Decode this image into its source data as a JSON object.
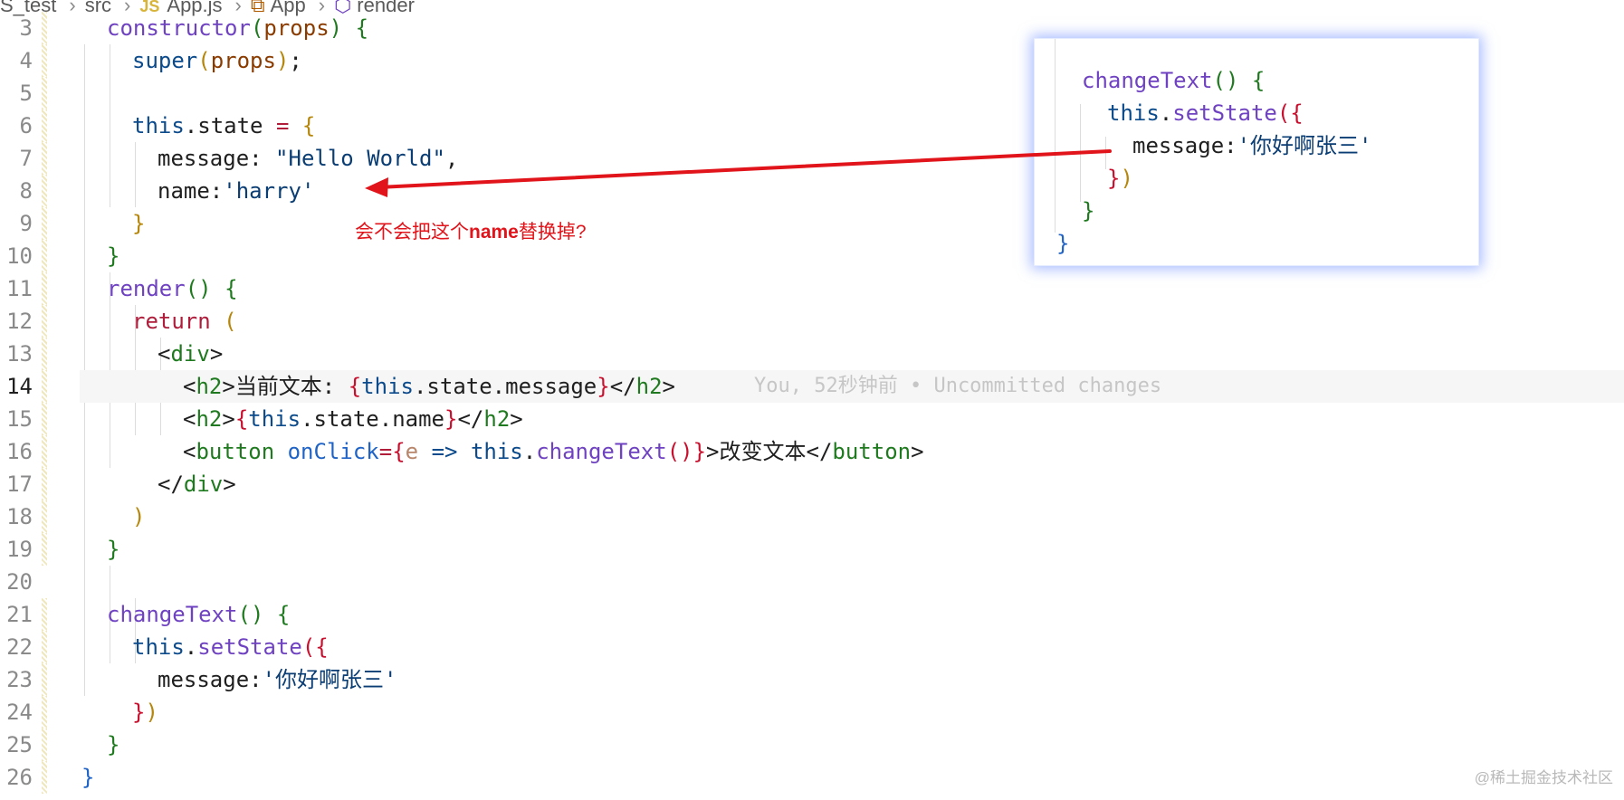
{
  "breadcrumb": {
    "segments": [
      "S_test",
      "src",
      "App.js",
      "App",
      "render"
    ],
    "js_badge": "JS"
  },
  "editor": {
    "line_numbers": [
      "3",
      "4",
      "5",
      "6",
      "7",
      "8",
      "9",
      "10",
      "11",
      "12",
      "13",
      "14",
      "15",
      "16",
      "17",
      "18",
      "19",
      "20",
      "21",
      "22",
      "23",
      "24",
      "25",
      "26"
    ],
    "active_line": "14",
    "code": {
      "l3": {
        "a": "constructor",
        "b": "(",
        "c": "props",
        "d": ")",
        "e": " ",
        "f": "{"
      },
      "l4": {
        "a": "super",
        "b": "(",
        "c": "props",
        "d": ")",
        "e": ";"
      },
      "l6": {
        "a": "this",
        "b": ".state ",
        "c": "=",
        "d": " ",
        "e": "{"
      },
      "l7": {
        "a": "message: ",
        "b": "\"Hello World\"",
        "c": ","
      },
      "l8": {
        "a": "name:",
        "b": "'harry'"
      },
      "l9": {
        "a": "}"
      },
      "l10": {
        "a": "}"
      },
      "l11": {
        "a": "render",
        "b": "()",
        "c": " ",
        "d": "{"
      },
      "l12": {
        "a": "return",
        "b": " ",
        "c": "("
      },
      "l13": {
        "a": "<",
        "b": "div",
        "c": ">"
      },
      "l14": {
        "a": "<",
        "b": "h2",
        "c": ">",
        "d": "当前文本: ",
        "e": "{",
        "f": "this",
        "g": ".state.message",
        "h": "}",
        "i": "</",
        "j": "h2",
        "k": ">"
      },
      "l15": {
        "a": "<",
        "b": "h2",
        "c": ">",
        "d": "{",
        "e": "this",
        "f": ".state.name",
        "g": "}",
        "h": "</",
        "i": "h2",
        "j": ">"
      },
      "l16": {
        "a": "<",
        "b": "button",
        "c": " ",
        "d": "onClick",
        "e": "=",
        "f": "{",
        "g": "e",
        "h": " ",
        "i": "=>",
        "j": " ",
        "k": "this",
        "l": ".",
        "m": "changeText",
        "n": "()",
        "o": "}",
        "p": ">改变文本</",
        "q": "button",
        "r": ">"
      },
      "l17": {
        "a": "</",
        "b": "div",
        "c": ">"
      },
      "l18": {
        "a": ")"
      },
      "l19": {
        "a": "}"
      },
      "l21": {
        "a": "changeText",
        "b": "()",
        "c": " ",
        "d": "{"
      },
      "l22": {
        "a": "this",
        "b": ".",
        "c": "setState",
        "d": "(",
        "e": "{"
      },
      "l23": {
        "a": "message:",
        "b": "'你好啊张三'"
      },
      "l24": {
        "a": "}",
        "b": ")"
      },
      "l25": {
        "a": "}"
      },
      "l26": {
        "a": "}"
      }
    },
    "blame": "You, 52秒钟前 • Uncommitted changes"
  },
  "annotation": {
    "prefix": "会不会把这个",
    "bold": "name",
    "suffix": "替换掉?"
  },
  "popup": {
    "l1": {
      "a": "changeText",
      "b": "()",
      "c": " ",
      "d": "{"
    },
    "l2": {
      "a": "this",
      "b": ".",
      "c": "setState",
      "d": "(",
      "e": "{"
    },
    "l3": {
      "a": "message:",
      "b": "'你好啊张三'"
    },
    "l4": {
      "a": "}",
      "b": ")"
    },
    "l5": {
      "a": "}"
    },
    "l6": {
      "a": "}"
    }
  },
  "watermark": "@稀土掘金技术社区",
  "colors": {
    "arrow": "#e0141a",
    "popup_glow": "#7896ff",
    "line_highlight": "#f6f6f6"
  }
}
